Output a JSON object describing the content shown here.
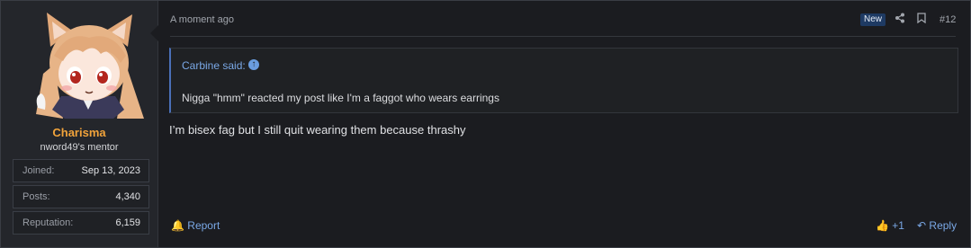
{
  "user": {
    "name": "Charisma",
    "title": "nword49's mentor",
    "stats": [
      {
        "label": "Joined:",
        "value": "Sep 13, 2023"
      },
      {
        "label": "Posts:",
        "value": "4,340"
      },
      {
        "label": "Reputation:",
        "value": "6,159"
      }
    ]
  },
  "post": {
    "timestamp": "A moment ago",
    "badge": "New",
    "number": "#12",
    "quote": {
      "author": "Carbine said:",
      "text": "Nigga \"hmm\" reacted my post like I'm a faggot who wears earrings"
    },
    "body": "I’m bisex fag but I still quit wearing them because thrashy",
    "actions": {
      "report": "Report",
      "like": "+1",
      "reply": "Reply"
    }
  },
  "colors": {
    "accent_link": "#7aa8e6",
    "username": "#f1a33b",
    "badge_bg": "#1e3a63"
  }
}
